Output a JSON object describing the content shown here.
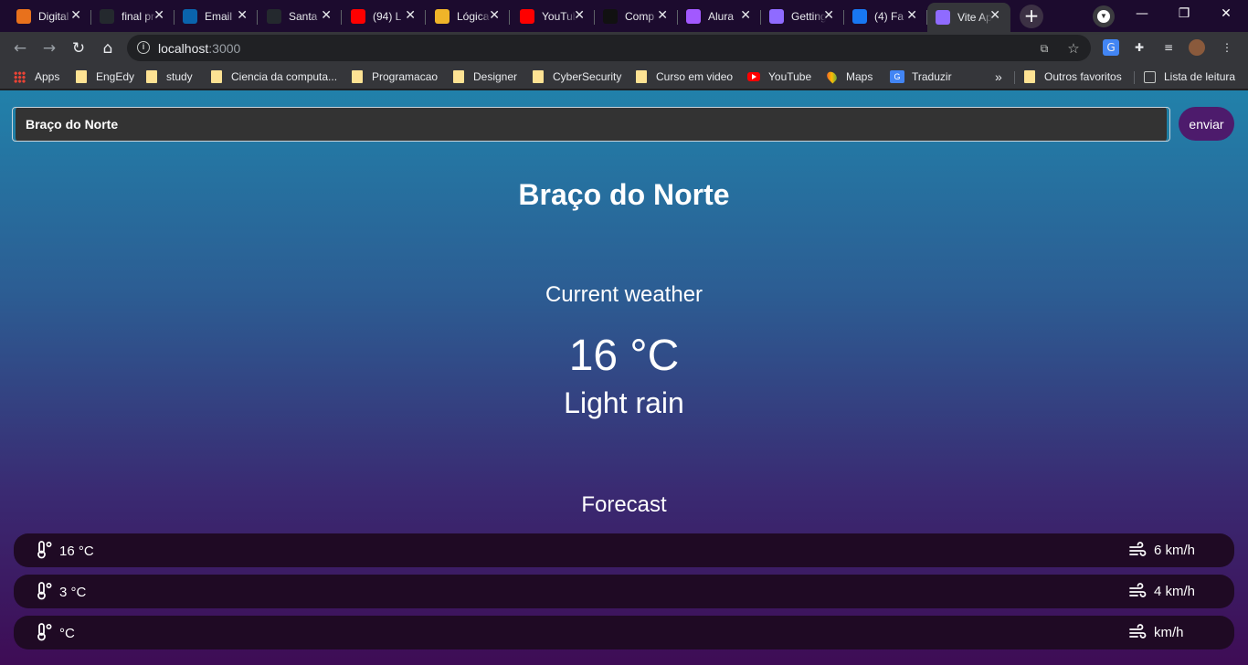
{
  "browser": {
    "tabs": [
      {
        "title": "Digital",
        "icon": "digital-favicon",
        "color": "#e8711c"
      },
      {
        "title": "final project",
        "icon": "github-favicon",
        "color": "#24292e"
      },
      {
        "title": "Email",
        "icon": "outlook-favicon",
        "color": "#0a64ad"
      },
      {
        "title": "Santa",
        "icon": "github-favicon",
        "color": "#24292e"
      },
      {
        "title": "(94) L",
        "icon": "youtube-favicon",
        "color": "#ff0000"
      },
      {
        "title": "Lógica",
        "icon": "logic-favicon",
        "color": "#f0b429"
      },
      {
        "title": "YouTube",
        "icon": "youtube-favicon",
        "color": "#ff0000"
      },
      {
        "title": "Comp",
        "icon": "amazon-favicon",
        "color": "#111111"
      },
      {
        "title": "Alura",
        "icon": "figma-favicon",
        "color": "#a259ff"
      },
      {
        "title": "Getting",
        "icon": "vite-favicon",
        "color": "#8f6bff"
      },
      {
        "title": "(4) Fa",
        "icon": "facebook-favicon",
        "color": "#1877f2"
      },
      {
        "title": "Vite App",
        "icon": "vite-favicon",
        "color": "#8f6bff",
        "active": true
      }
    ],
    "url_host": "localhost",
    "url_port": ":3000",
    "bookmarks": [
      {
        "label": "Apps",
        "type": "apps"
      },
      {
        "label": "EngEdy",
        "type": "folder"
      },
      {
        "label": "study",
        "type": "folder"
      },
      {
        "label": "Ciencia da computa...",
        "type": "folder"
      },
      {
        "label": "Programacao",
        "type": "folder"
      },
      {
        "label": "Designer",
        "type": "folder"
      },
      {
        "label": "CyberSecurity",
        "type": "folder"
      },
      {
        "label": "Curso em video",
        "type": "folder"
      },
      {
        "label": "YouTube",
        "type": "youtube"
      },
      {
        "label": "Maps",
        "type": "maps"
      },
      {
        "label": "Traduzir",
        "type": "translate"
      }
    ],
    "bookmarks_overflow": "»",
    "other_bookmarks": "Outros favoritos",
    "reading_list": "Lista de leitura"
  },
  "app": {
    "search_value": "Braço do Norte",
    "send_label": "enviar",
    "city": "Braço do Norte",
    "current_label": "Current weather",
    "current_temp": "16 °C",
    "current_desc": "Light rain",
    "forecast_label": "Forecast",
    "forecast": [
      {
        "temp": "16 °C",
        "wind": "6 km/h"
      },
      {
        "temp": "3 °C",
        "wind": "4 km/h"
      },
      {
        "temp": "°C",
        "wind": "km/h"
      }
    ]
  },
  "colors": {
    "gradient_top": "#2181aa",
    "gradient_bottom": "#3e0c55",
    "button": "#4d1b6c",
    "forecast_row": "#1f0a24"
  }
}
